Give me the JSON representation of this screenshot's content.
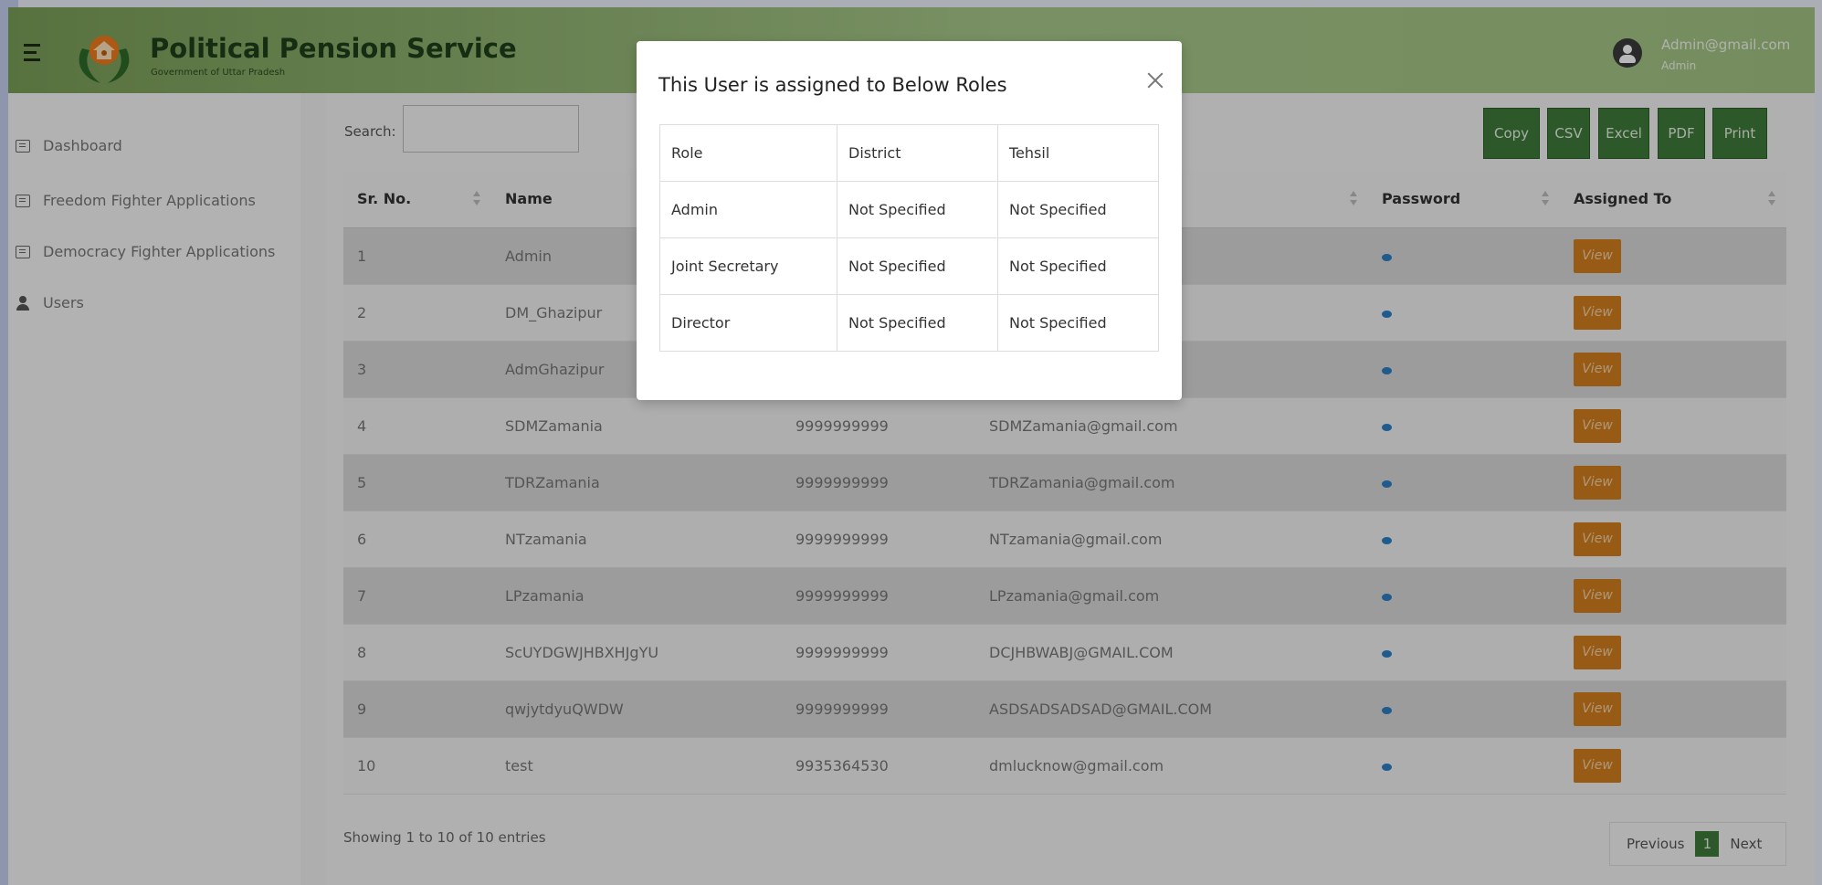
{
  "header": {
    "title": "Political Pension Service",
    "subtitle": "Government of Uttar Pradesh",
    "user_email": "Admin@gmail.com",
    "user_role": "Admin",
    "accent": "#7a9e58"
  },
  "sidebar": {
    "items": [
      {
        "label": "Dashboard",
        "icon": "list-icon"
      },
      {
        "label": "Freedom Fighter Applications",
        "icon": "list-icon"
      },
      {
        "label": "Democracy Fighter Applications",
        "icon": "list-icon"
      },
      {
        "label": "Users",
        "icon": "user-icon"
      }
    ]
  },
  "toolbar": {
    "search_label": "Search:",
    "search_value": "",
    "exports": [
      "Copy",
      "CSV",
      "Excel",
      "PDF",
      "Print"
    ]
  },
  "table": {
    "headers": [
      "Sr. No.",
      "Name",
      "",
      "",
      "Password",
      "Assigned To"
    ],
    "view_label": "View",
    "rows": [
      {
        "sr": "1",
        "name": "Admin",
        "mobile": "",
        "email": ""
      },
      {
        "sr": "2",
        "name": "DM_Ghazipur",
        "mobile": "",
        "email": ""
      },
      {
        "sr": "3",
        "name": "AdmGhazipur",
        "mobile": "",
        "email": ""
      },
      {
        "sr": "4",
        "name": "SDMZamania",
        "mobile": "9999999999",
        "email": "SDMZamania@gmail.com"
      },
      {
        "sr": "5",
        "name": "TDRZamania",
        "mobile": "9999999999",
        "email": "TDRZamania@gmail.com"
      },
      {
        "sr": "6",
        "name": "NTzamania",
        "mobile": "9999999999",
        "email": "NTzamania@gmail.com"
      },
      {
        "sr": "7",
        "name": "LPzamania",
        "mobile": "9999999999",
        "email": "LPzamania@gmail.com"
      },
      {
        "sr": "8",
        "name": "ScUYDGWJHBXHJgYU",
        "mobile": "9999999999",
        "email": "DCJHBWABJ@GMAIL.COM"
      },
      {
        "sr": "9",
        "name": "qwjytdyuQWDW",
        "mobile": "9999999999",
        "email": "ASDSADSADSAD@GMAIL.COM"
      },
      {
        "sr": "10",
        "name": "test",
        "mobile": "9935364530",
        "email": "dmlucknow@gmail.com"
      }
    ]
  },
  "footer": {
    "info": "Showing 1 to 10 of 10 entries",
    "previous": "Previous",
    "page": "1",
    "next": "Next"
  },
  "modal": {
    "title": "This User is assigned to Below Roles",
    "columns": [
      "Role",
      "District",
      "Tehsil"
    ],
    "rows": [
      {
        "role": "Admin",
        "district": "Not Specified",
        "tehsil": "Not Specified"
      },
      {
        "role": "Joint Secretary",
        "district": "Not Specified",
        "tehsil": "Not Specified"
      },
      {
        "role": "Director",
        "district": "Not Specified",
        "tehsil": "Not Specified"
      }
    ]
  }
}
